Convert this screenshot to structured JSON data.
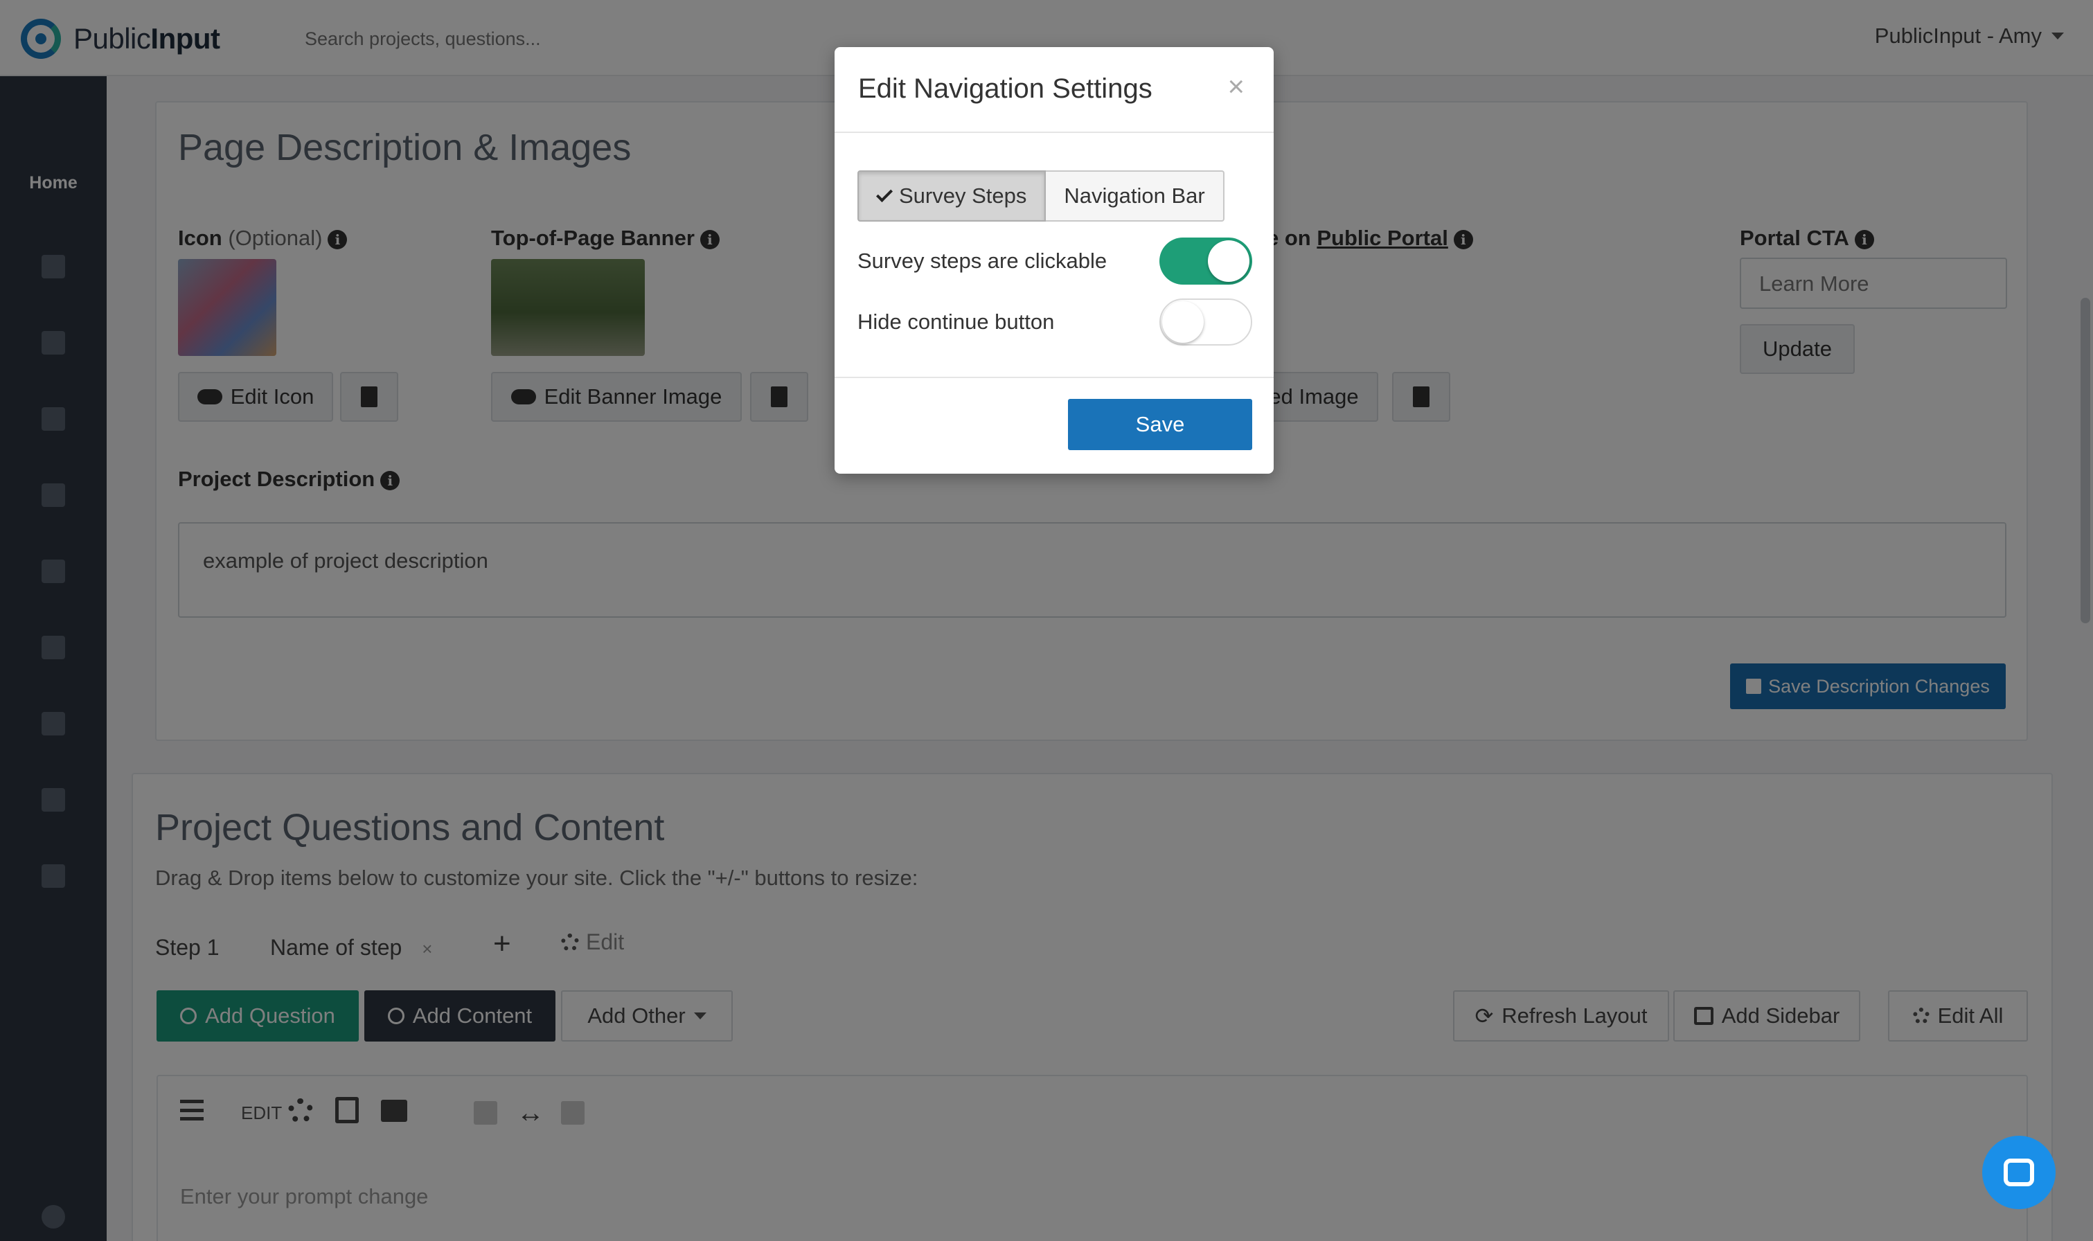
{
  "app": {
    "logo_text_light": "Public",
    "logo_text_bold": "Input",
    "search_placeholder": "Search projects, questions...",
    "user_menu_label": "PublicInput - Amy"
  },
  "sidebar": {
    "home_label": "Home",
    "icons": [
      "calendar-icon",
      "document-icon",
      "map-icon",
      "share-icon",
      "contacts-icon",
      "inbox-icon",
      "report-icon",
      "sparkle-icon",
      "settings-icon",
      "help-icon"
    ]
  },
  "page_description": {
    "heading": "Page Description & Images",
    "icon_label": "Icon",
    "icon_optional": "(Optional)",
    "banner_label": "Top-of-Page Banner",
    "portal_label_prefix": "e on",
    "portal_link": "Public Portal",
    "portal_cta_label": "Portal CTA",
    "portal_cta_value": "Learn More",
    "update_label": "Update",
    "edit_icon_label": "Edit Icon",
    "edit_banner_label": "Edit Banner Image",
    "edit_featured_label": "ed Image",
    "project_description_label": "Project Description",
    "project_description_value": "example of project description",
    "save_description_label": "Save Description Changes"
  },
  "questions": {
    "heading": "Project Questions and Content",
    "subheading": "Drag & Drop items below to customize your site. Click the \"+/-\" buttons to resize:",
    "step_tab": "Step 1",
    "step_name": "Name of step",
    "add_step_label": "+",
    "edit_label": "Edit",
    "add_question_label": "Add Question",
    "add_content_label": "Add Content",
    "add_other_label": "Add Other",
    "refresh_label": "Refresh Layout",
    "add_sidebar_label": "Add Sidebar",
    "edit_all_label": "Edit All",
    "card_edit_label": "EDIT",
    "prompt_placeholder": "Enter your prompt change"
  },
  "modal": {
    "title": "Edit Navigation Settings",
    "close_label": "×",
    "tabs": [
      {
        "label": "Survey Steps",
        "active": true
      },
      {
        "label": "Navigation Bar",
        "active": false
      }
    ],
    "options": [
      {
        "label": "Survey steps are clickable",
        "enabled": true
      },
      {
        "label": "Hide continue button",
        "enabled": false
      }
    ],
    "save_label": "Save"
  },
  "colors": {
    "primary": "#1a73b8",
    "toggle_on": "#1e9e77",
    "sidebar": "#2e3642",
    "chat": "#1a8fe8"
  }
}
